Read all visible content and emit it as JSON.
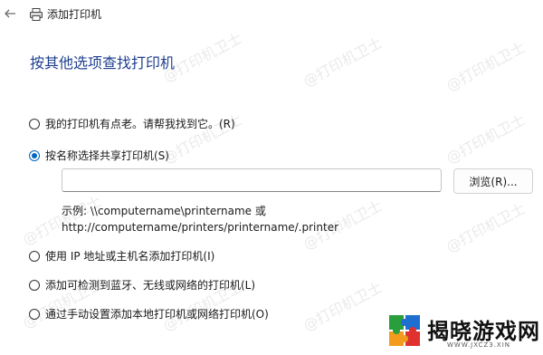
{
  "window": {
    "title": "添加打印机"
  },
  "heading": "按其他选项查找打印机",
  "options": [
    {
      "label": "我的打印机有点老。请帮我找到它。(R)",
      "checked": false
    },
    {
      "label": "按名称选择共享打印机(S)",
      "checked": true
    },
    {
      "label": "使用 IP 地址或主机名添加打印机(I)",
      "checked": false
    },
    {
      "label": "添加可检测到蓝牙、无线或网络的打印机(L)",
      "checked": false
    },
    {
      "label": "通过手动设置添加本地打印机或网络打印机(O)",
      "checked": false
    }
  ],
  "share_input": {
    "value": ""
  },
  "browse_label": "浏览(R)...",
  "example": {
    "line1": "示例: \\\\computername\\printername 或",
    "line2": "http://computername/printers/printername/.printer"
  },
  "watermark": "@打印机卫士",
  "logo": {
    "text": "揭晓游戏网",
    "domain": "WWW.JXCZ3.XIN"
  },
  "colors": {
    "accent": "#0067c0",
    "heading": "#1f3f8f"
  },
  "icons": {
    "back": "back-arrow-icon",
    "printer": "printer-icon"
  }
}
